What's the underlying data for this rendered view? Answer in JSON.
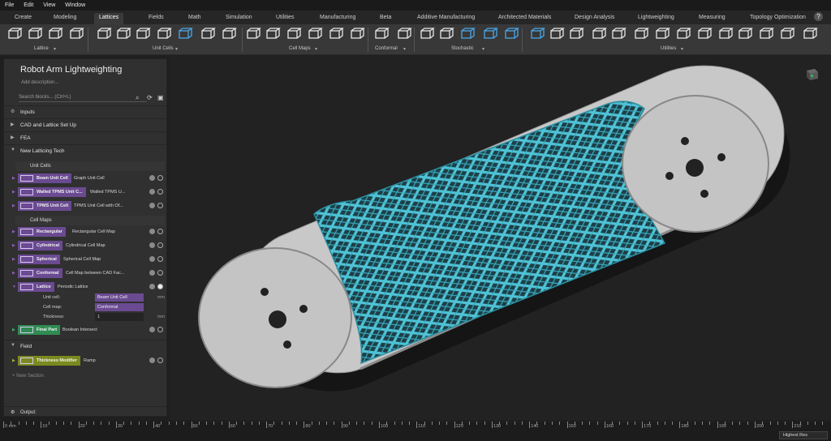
{
  "menu": [
    "File",
    "Edit",
    "View",
    "Window"
  ],
  "tabs": [
    "Create",
    "Modeling",
    "Lattices",
    "Fields",
    "Math",
    "Simulation",
    "Utilities",
    "Manufacturing",
    "Beta",
    "Additive Manufacturing",
    "Architected Materials",
    "Design Analysis",
    "Lightweighting",
    "Measuring",
    "Topology Optimization"
  ],
  "active_tab": "Lattices",
  "ribbon_groups": [
    "Lattice",
    "Unit Cells",
    "Cell Maps",
    "Conformal",
    "Stochastic",
    "Utilities"
  ],
  "project": {
    "title": "Robot Arm Lightweighting",
    "description_placeholder": "Add description...",
    "search_placeholder": "Search blocks... (Ctrl+L)"
  },
  "sections": {
    "inputs": "Inputs",
    "cad": "CAD and Lattice Set Up",
    "fea": "FEA",
    "tech": "New Latticing Tech",
    "field": "Field",
    "new_section": "+ New Section",
    "output": "Output:"
  },
  "subheads": {
    "unit_cells": "Unit Cells",
    "cell_maps": "Cell Maps"
  },
  "blocks": {
    "beam": {
      "tag": "Beam Unit Cell",
      "desc": "Graph Unit Cell"
    },
    "walled": {
      "tag": "Walled TPMS Unit C...",
      "desc": "Walled TPMS U..."
    },
    "tpms": {
      "tag": "TPMS Unit Cell",
      "desc": "TPMS Unit Cell with Of..."
    },
    "rect": {
      "tag": "Rectangular",
      "desc": "Rectangular Cell Map"
    },
    "cyl": {
      "tag": "Cylindrical",
      "desc": "Cylindrical Cell Map"
    },
    "sph": {
      "tag": "Spherical",
      "desc": "Spherical Cell Map"
    },
    "conf": {
      "tag": "Conformal",
      "desc": "Cell Map between CAD Fac..."
    },
    "lattice": {
      "tag": "Lattice",
      "desc": "Periodic Lattice"
    },
    "final": {
      "tag": "Final Part",
      "desc": "Boolean Intersect"
    },
    "thick": {
      "tag": "Thickness Modifier",
      "desc": "Ramp"
    }
  },
  "lattice_inputs": {
    "unit_cell_label": "Unit cell:",
    "unit_cell_value": "Beam Unit Cell",
    "cell_map_label": "Cell map:",
    "cell_map_value": "Conformal",
    "thickness_label": "Thickness:",
    "thickness_value": "1",
    "unit": "mm"
  },
  "ruler": {
    "labels": [
      "0 mm",
      "10",
      "20",
      "30",
      "40",
      "50",
      "60",
      "70",
      "80",
      "90",
      "100",
      "110",
      "120",
      "130",
      "140",
      "150",
      "160",
      "170",
      "180",
      "190",
      "200",
      "210",
      "220"
    ]
  },
  "resolution": "Highest Res",
  "colors": {
    "accent_purple": "#6a4a91",
    "accent_green": "#2f8c52",
    "lattice": "#4fc3d6",
    "part": "#c8c8c8"
  }
}
